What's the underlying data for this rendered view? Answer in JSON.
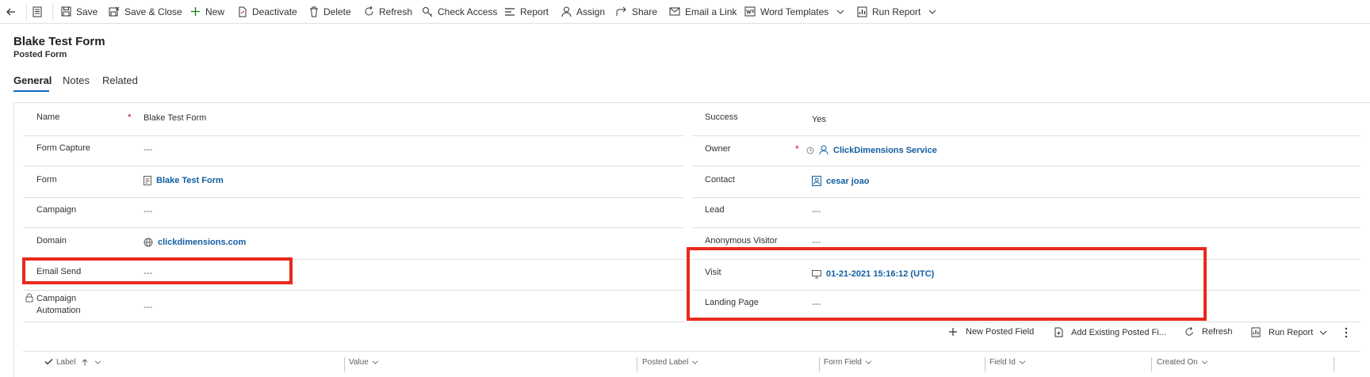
{
  "command_bar": {
    "save": "Save",
    "save_close": "Save & Close",
    "new": "New",
    "deactivate": "Deactivate",
    "delete": "Delete",
    "refresh": "Refresh",
    "check_access": "Check Access",
    "report": "Report",
    "assign": "Assign",
    "share": "Share",
    "email_link": "Email a Link",
    "word_templates": "Word Templates",
    "run_report": "Run Report"
  },
  "header": {
    "title": "Blake Test Form",
    "subtitle": "Posted Form"
  },
  "tabs": [
    "General",
    "Notes",
    "Related"
  ],
  "form": {
    "left": [
      {
        "label": "Name",
        "value": "Blake Test Form",
        "required": true
      },
      {
        "label": "Form Capture",
        "value": "---"
      },
      {
        "label": "Form",
        "value": "Blake Test Form",
        "link": true
      },
      {
        "label": "Campaign",
        "value": "---"
      },
      {
        "label": "Domain",
        "value": "clickdimensions.com",
        "link": true
      },
      {
        "label": "Email Send",
        "value": "---"
      },
      {
        "label": "Campaign Automation",
        "label_line1": "Campaign",
        "label_line2": "Automation",
        "value": "---",
        "locked": true
      }
    ],
    "right": [
      {
        "label": "Success",
        "value": "Yes"
      },
      {
        "label": "Owner",
        "value": "ClickDimensions Service",
        "required": true,
        "link": true
      },
      {
        "label": "Contact",
        "value": "cesar joao",
        "link": true
      },
      {
        "label": "Lead",
        "value": "---"
      },
      {
        "label": "Anonymous Visitor",
        "value": "---"
      },
      {
        "label": "Visit",
        "value": "01-21-2021 15:16:12 (UTC)",
        "link": true
      },
      {
        "label": "Landing Page",
        "value": "---"
      }
    ]
  },
  "subgrid": {
    "commands": {
      "new_posted_field": "New Posted Field",
      "add_existing": "Add Existing Posted Fi...",
      "refresh": "Refresh",
      "run_report": "Run Report"
    },
    "columns": [
      "Label",
      "Value",
      "Posted Label",
      "Form Field",
      "Field Id",
      "Created On"
    ]
  },
  "colors": {
    "accent": "#0f6cbd",
    "link": "#115ea3",
    "required": "#c50f1f",
    "highlight": "#e8291c"
  },
  "icons": [
    "back-arrow-icon",
    "form-icon",
    "save-icon",
    "save-close-icon",
    "plus-icon",
    "deactivate-icon",
    "delete-icon",
    "refresh-icon",
    "key-icon",
    "report-icon",
    "person-icon",
    "share-icon",
    "email-icon",
    "word-icon",
    "run-report-icon",
    "chevron-down-icon",
    "lock-icon",
    "globe-icon",
    "monitor-icon",
    "contact-card-icon",
    "more-icon",
    "checkmark-icon",
    "sort-up-icon"
  ]
}
